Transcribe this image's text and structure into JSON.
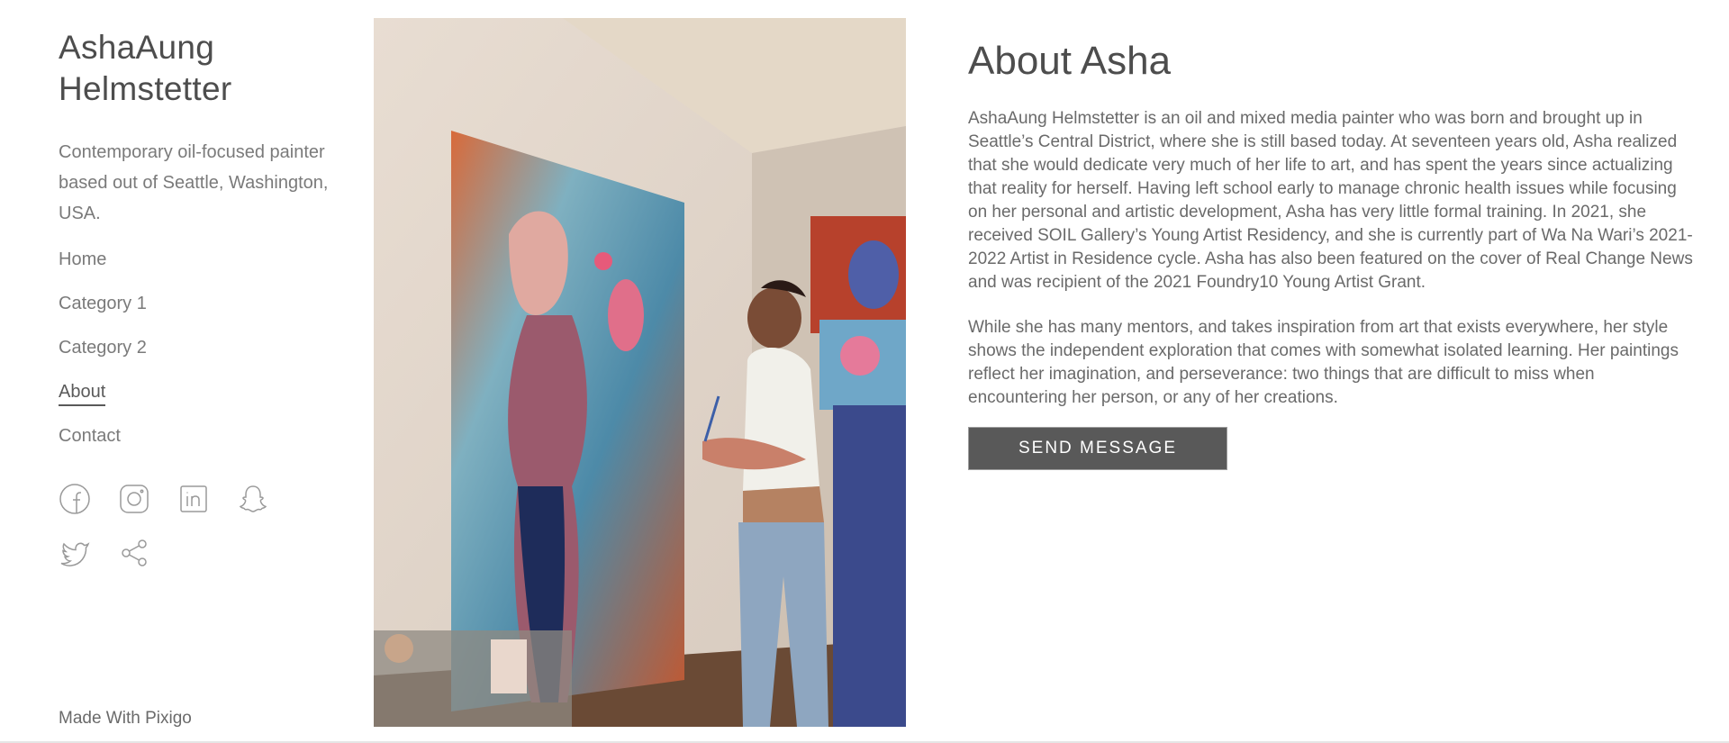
{
  "site": {
    "title_line1": "AshaAung",
    "title_line2": "Helmstetter",
    "tagline": "Contemporary oil-focused painter based out of Seattle, Washington, USA."
  },
  "nav": [
    {
      "label": "Home",
      "active": false
    },
    {
      "label": "Category 1",
      "active": false
    },
    {
      "label": "Category 2",
      "active": false
    },
    {
      "label": "About",
      "active": true
    },
    {
      "label": "Contact",
      "active": false
    }
  ],
  "social_icons": [
    "facebook-icon",
    "instagram-icon",
    "linkedin-icon",
    "snapchat-icon",
    "twitter-icon",
    "share-icon"
  ],
  "footer": {
    "made_with": "Made With Pixigo"
  },
  "about": {
    "title": "About Asha",
    "paragraph1": "AshaAung Helmstetter is an oil and mixed media painter who was born and brought up in Seattle’s Central District, where she is still based today. At seventeen years old, Asha realized that she would dedicate very much of her life to art, and has spent the years since actualizing that reality for herself. Having left school early to manage chronic health issues while focusing on her personal and artistic development, Asha has very little formal training. In 2021, she received SOIL Gallery’s Young Artist Residency, and she is currently part of Wa Na Wari’s 2021-2022 Artist in Residence cycle. Asha has also been featured on the cover of Real Change News and was recipient of the 2021 Foundry10 Young Artist Grant.",
    "paragraph2": "While she has many mentors, and takes inspiration from art that exists everywhere, her style shows the independent exploration that comes with somewhat isolated learning. Her paintings reflect her imagination, and perseverance: two things that are difficult to miss when encountering her person, or any of her creations.",
    "button_label": "SEND MESSAGE"
  },
  "colors": {
    "text": "#5a5a5a",
    "muted": "#7a7a7a",
    "button_bg": "#595959",
    "button_text": "#ffffff"
  }
}
